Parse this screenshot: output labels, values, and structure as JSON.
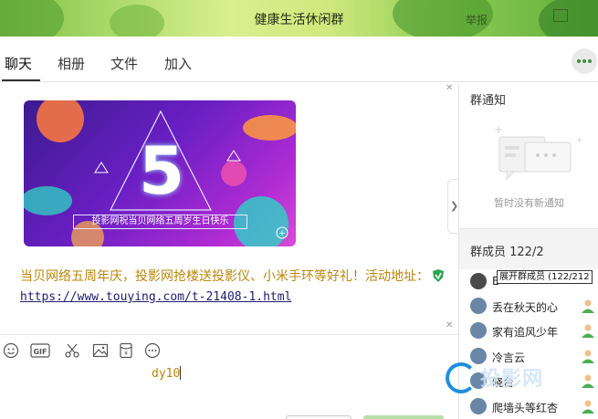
{
  "window": {
    "title": "健康生活休闲群",
    "right_text": "举报"
  },
  "tabs": [
    {
      "label": "聊天",
      "active": true
    },
    {
      "label": "相册",
      "active": false
    },
    {
      "label": "文件",
      "active": false
    },
    {
      "label": "加入",
      "active": false
    }
  ],
  "banner": {
    "big_number": "5",
    "caption": "投影网祝当贝网络五周岁生日快乐"
  },
  "message": {
    "text": "当贝网络五周年庆，投影网抢楼送投影仪、小米手环等好礼！活动地址：",
    "link": "https://www.touying.com/t-21408-1.html"
  },
  "input": {
    "value": "dy10"
  },
  "right_panel": {
    "notice_title": "群通知",
    "notice_empty": "暂时没有新通知",
    "members_title": "群成员 122/2",
    "tooltip": "展开群成员 (122/212",
    "members": [
      {
        "name": "E"
      },
      {
        "name": "丢在秋天的心"
      },
      {
        "name": "家有追风少年"
      },
      {
        "name": "冷言云"
      },
      {
        "name": "晓台"
      },
      {
        "name": "爬墙头等红杏"
      }
    ]
  },
  "watermark": {
    "text": "投影网"
  },
  "colors": {
    "accent_green": "#3b8f3b",
    "message_text": "#b8860b",
    "send_button": "#b6dfa8"
  }
}
